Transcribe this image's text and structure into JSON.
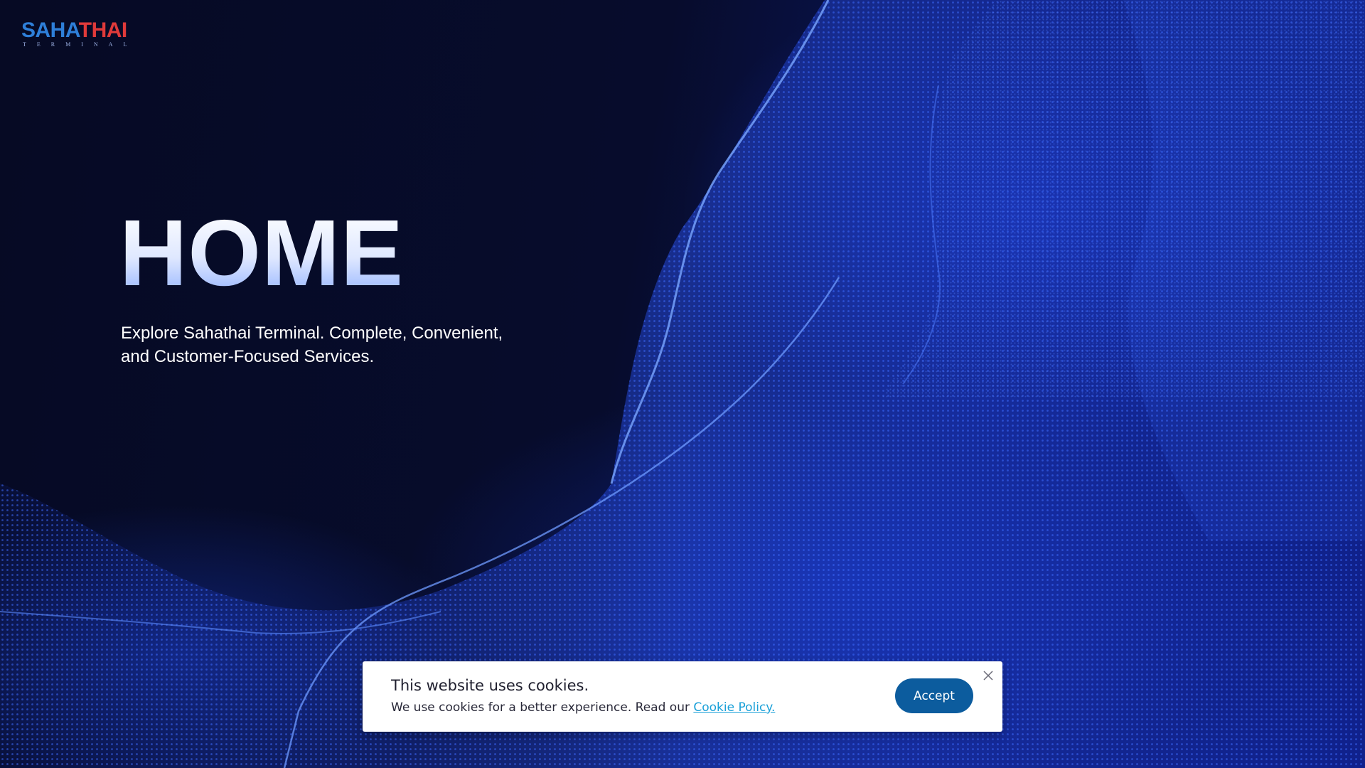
{
  "header": {
    "logo_text_part1": "SAHA",
    "logo_text_part2": "THAI",
    "logo_subtext": "TERMINAL"
  },
  "hero": {
    "title": "HOME",
    "subtitle_line1": "Explore Sahathai Terminal. Complete, Convenient,",
    "subtitle_line2": "and Customer-Focused Services."
  },
  "cookie_banner": {
    "title": "This website uses cookies.",
    "text": "We use cookies for a better experience. Read our ",
    "link_label": "Cookie Policy.",
    "accept_label": "Accept",
    "close_icon": "close-icon"
  },
  "colors": {
    "background": "#050a26",
    "wave_blue": "#2a5cff",
    "accept_button": "#0c5c9e",
    "link": "#1aa0d8",
    "logo_blue": "#2e7fd9",
    "logo_red": "#e03a3a"
  }
}
